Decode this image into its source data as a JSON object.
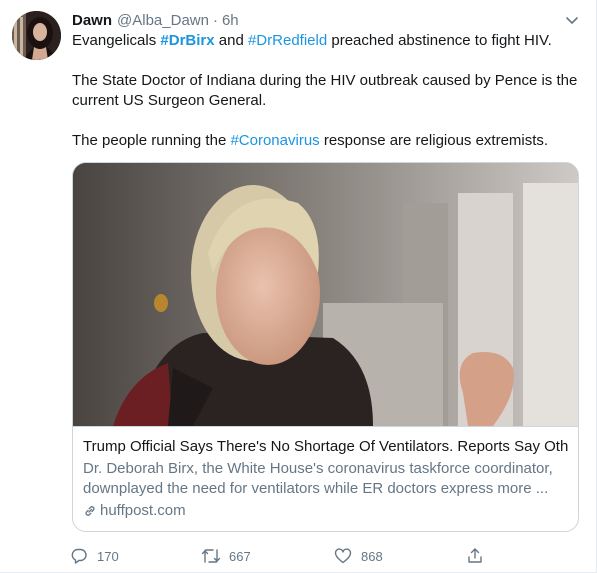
{
  "tweet": {
    "display_name": "Dawn",
    "handle": "@Alba_Dawn",
    "separator": "·",
    "time": "6h",
    "text": {
      "p1_a": "Evangelicals ",
      "p1_tag1": "#DrBirx",
      "p1_b": " and ",
      "p1_tag2": "#DrRedfield",
      "p1_c": " preached abstinence to fight HIV.",
      "p2": "The State Doctor of Indiana during the HIV outbreak caused by Pence is the current US Surgeon General.",
      "p3_a": "The people running the ",
      "p3_tag": "#Coronavirus",
      "p3_b": " response are religious extremists."
    },
    "card": {
      "title": "Trump Official Says There's No Shortage Of Ventilators. Reports Say Oth...",
      "description": "Dr. Deborah Birx, the White House's coronavirus taskforce coordinator, downplayed the need for ventilators while ER doctors express more ...",
      "domain": "huffpost.com"
    },
    "actions": {
      "reply_count": "170",
      "retweet_count": "667",
      "like_count": "868"
    }
  },
  "colors": {
    "link": "#1b95e0",
    "secondary_text": "#657786",
    "border": "#ccd6dd"
  },
  "icons": [
    "chevron-down-icon",
    "reply-icon",
    "retweet-icon",
    "like-icon",
    "share-icon",
    "link-icon"
  ]
}
